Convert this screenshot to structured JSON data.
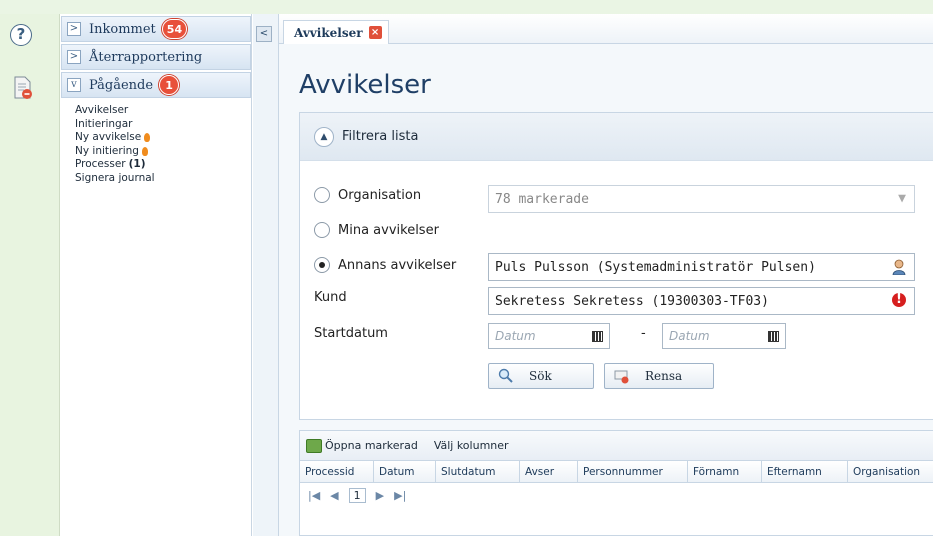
{
  "nav": {
    "sections": [
      {
        "label": "Inkommet",
        "badge": "54",
        "toggle": ">"
      },
      {
        "label": "Återrapportering",
        "badge": "",
        "toggle": ">"
      },
      {
        "label": "Pågående",
        "badge": "1",
        "toggle": "v"
      }
    ],
    "items": [
      {
        "label": "Avvikelser",
        "suffix": ""
      },
      {
        "label": "Initieringar",
        "suffix": ""
      },
      {
        "label": "Ny avvikelse",
        "suffix": ""
      },
      {
        "label": "Ny initiering",
        "suffix": ""
      },
      {
        "label": "Processer",
        "suffix": "(1)"
      },
      {
        "label": "Signera journal",
        "suffix": ""
      }
    ],
    "collapse_glyph": "<"
  },
  "rail": {
    "help_glyph": "?"
  },
  "tab": {
    "label": "Avvikelser",
    "close_glyph": "×"
  },
  "page": {
    "title": "Avvikelser"
  },
  "filter": {
    "title": "Filtrera lista",
    "options": {
      "organisation": "Organisation",
      "mina": "Mina avvikelser",
      "annans": "Annans avvikelser"
    },
    "selected_option": "annans",
    "organisation_value": "78 markerade",
    "annans_value": "Puls Pulsson (Systemadministratör Pulsen)",
    "kund_label": "Kund",
    "kund_value": "Sekretess Sekretess (19300303-TF03)",
    "startdatum_label": "Startdatum",
    "date_placeholder": "Datum",
    "date_separator": "-",
    "search_button": "Sök",
    "clear_button": "Rensa"
  },
  "grid": {
    "toolbar": {
      "open": "Öppna markerad",
      "columns": "Välj kolumner"
    },
    "columns": [
      "Processid",
      "Datum",
      "Slutdatum",
      "Avser",
      "Personnummer",
      "Förnamn",
      "Efternamn",
      "Organisation"
    ],
    "pager": {
      "first": "|◀",
      "prev": "◀",
      "page": "1",
      "next": "▶",
      "last": "▶|"
    }
  },
  "colors": {
    "badge": "#e8503a",
    "title": "#1f3f66",
    "rail": "#e8f4e0"
  }
}
